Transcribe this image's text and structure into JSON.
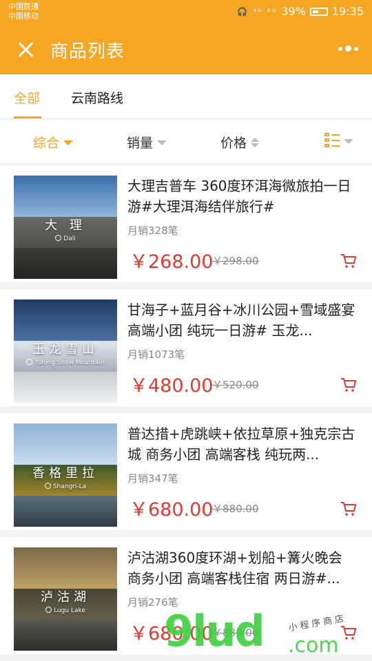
{
  "status_bar": {
    "carrier_1": "中国联通",
    "carrier_2": "中国移动",
    "signal_text": "🎧 ⁴ᴳ ²ᴳ",
    "battery": "39%",
    "time": "19:35"
  },
  "header": {
    "title": "商品列表",
    "background_color": "#f5a623"
  },
  "tabs": [
    {
      "label": "全部",
      "active": true
    },
    {
      "label": "云南路线",
      "active": false
    }
  ],
  "filters": [
    {
      "label": "综合",
      "active": true
    },
    {
      "label": "销量",
      "active": false
    },
    {
      "label": "价格",
      "active": false
    }
  ],
  "products": [
    {
      "title": "大理吉普车 360度环洱海微旅拍一日游#大理洱海结伴旅行#",
      "image_name": "大 理",
      "image_sub": "Dali",
      "sales": "月销328笔",
      "price": "￥268.00",
      "old_price": "￥298.00"
    },
    {
      "title": "甘海子+蓝月谷+冰川公园+雪域盛宴 高端小团 纯玩一日游# 玉龙...",
      "image_name": "玉龙雪山",
      "image_sub": "Yulong Snow Mountain",
      "sales": "月销1073笔",
      "price": "￥480.00",
      "old_price": "￥520.00"
    },
    {
      "title": "普达措+虎跳峡+依拉草原+独克宗古城 商务小团 高端客栈 纯玩两...",
      "image_name": "香格里拉",
      "image_sub": "Shangri-La",
      "sales": "月销347笔",
      "price": "￥680.00",
      "old_price": "￥880.00"
    },
    {
      "title": "泸沽湖360度环湖+划船+篝火晚会 商务小团 高端客栈住宿 两日游#...",
      "image_name": "泸沽湖",
      "image_sub": "Lugu Lake",
      "sales": "月销276笔",
      "price": "￥680.00",
      "old_price": "￥880.00"
    }
  ],
  "watermark": {
    "brand": "9lud",
    "domain": ".com",
    "caption": "小程序商店"
  },
  "colors": {
    "accent": "#f5a623",
    "price": "#e03a2f"
  }
}
